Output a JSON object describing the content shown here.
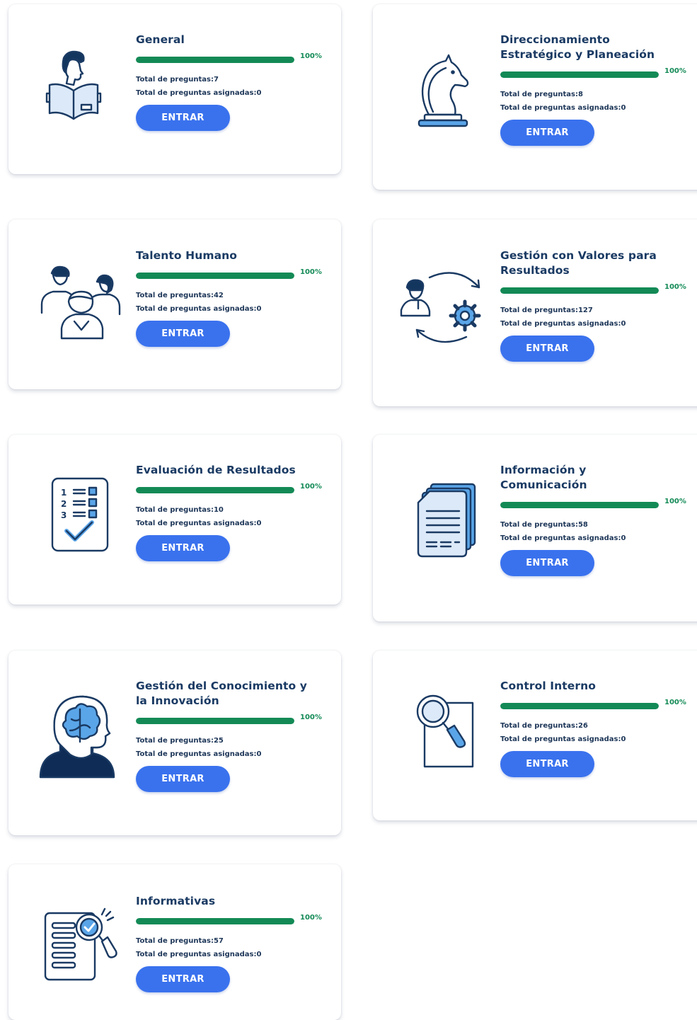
{
  "button_label": "ENTRAR",
  "colors": {
    "progress": "#138a56",
    "button": "#3a72ee",
    "title": "#1a3a63",
    "icon_accent": "#5aa5e8"
  },
  "modules": [
    {
      "title_line1": "General",
      "title_line2": "",
      "progress": 100,
      "progress_label": "100%",
      "total_preguntas": "Total de preguntas:7",
      "total_asignadas": "Total de preguntas asignadas:0",
      "icon": "person-reading-book-icon"
    },
    {
      "title_line1": "Direccionamiento",
      "title_line2": "Estratégico y Planeación",
      "progress": 100,
      "progress_label": "100%",
      "total_preguntas": "Total de preguntas:8",
      "total_asignadas": "Total de preguntas asignadas:0",
      "icon": "chess-knight-icon"
    },
    {
      "title_line1": "Talento Humano",
      "title_line2": "",
      "progress": 100,
      "progress_label": "100%",
      "total_preguntas": "Total de preguntas:42",
      "total_asignadas": "Total de preguntas asignadas:0",
      "icon": "people-group-icon"
    },
    {
      "title_line1": "Gestión con Valores para",
      "title_line2": "Resultados",
      "progress": 100,
      "progress_label": "100%",
      "total_preguntas": "Total de preguntas:127",
      "total_asignadas": "Total de preguntas asignadas:0",
      "icon": "person-cycle-gear-icon"
    },
    {
      "title_line1": "Evaluación de Resultados",
      "title_line2": "",
      "progress": 100,
      "progress_label": "100%",
      "total_preguntas": "Total de preguntas:10",
      "total_asignadas": "Total de preguntas asignadas:0",
      "icon": "checklist-icon"
    },
    {
      "title_line1": "Información y",
      "title_line2": "Comunicación",
      "progress": 100,
      "progress_label": "100%",
      "total_preguntas": "Total de preguntas:58",
      "total_asignadas": "Total de preguntas asignadas:0",
      "icon": "documents-stack-icon"
    },
    {
      "title_line1": "Gestión del Conocimiento y",
      "title_line2": "la Innovación",
      "progress": 100,
      "progress_label": "100%",
      "total_preguntas": "Total de preguntas:25",
      "total_asignadas": "Total de preguntas asignadas:0",
      "icon": "brain-head-icon"
    },
    {
      "title_line1": "Control Interno",
      "title_line2": "",
      "progress": 100,
      "progress_label": "100%",
      "total_preguntas": "Total de preguntas:26",
      "total_asignadas": "Total de preguntas asignadas:0",
      "icon": "magnifier-document-icon"
    },
    {
      "title_line1": "Informativas",
      "title_line2": "",
      "progress": 100,
      "progress_label": "100%",
      "total_preguntas": "Total de preguntas:57",
      "total_asignadas": "Total de preguntas asignadas:0",
      "icon": "document-search-icon"
    }
  ]
}
